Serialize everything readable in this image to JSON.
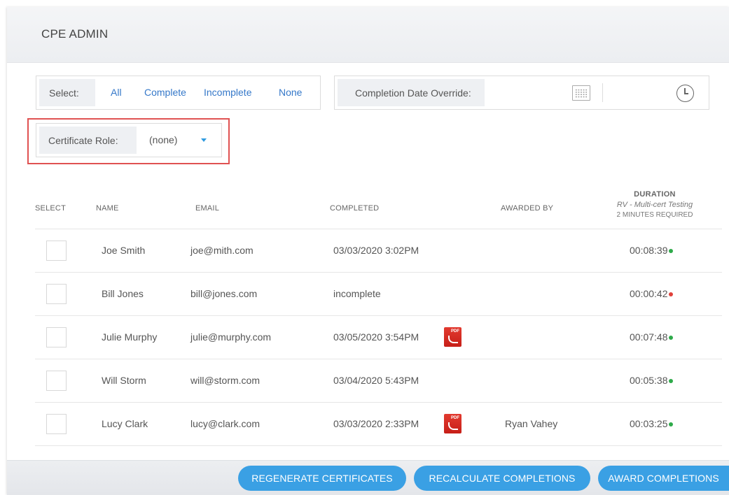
{
  "header": {
    "title": "CPE ADMIN"
  },
  "select": {
    "label": "Select:",
    "options": [
      "All",
      "Complete",
      "Incomplete",
      "None"
    ]
  },
  "date_override": {
    "label": "Completion Date Override:"
  },
  "certificate_role": {
    "label": "Certificate Role:",
    "value": "(none)"
  },
  "table": {
    "headers": {
      "select": "SELECT",
      "name": "NAME",
      "email": "EMAIL",
      "completed": "COMPLETED",
      "awarded_by": "AWARDED BY",
      "duration": "DURATION",
      "duration_sub": "RV - Multi-cert Testing",
      "duration_req": "2 MINUTES REQUIRED"
    },
    "rows": [
      {
        "name": "Joe Smith",
        "email": "joe@mith.com",
        "completed": "03/03/2020 3:02PM",
        "pdf": false,
        "awarded_by": "",
        "duration": "00:08:39",
        "status": "green"
      },
      {
        "name": "Bill Jones",
        "email": "bill@jones.com",
        "completed": "incomplete",
        "pdf": false,
        "awarded_by": "",
        "duration": "00:00:42",
        "status": "red"
      },
      {
        "name": "Julie Murphy",
        "email": "julie@murphy.com",
        "completed": "03/05/2020 3:54PM",
        "pdf": true,
        "awarded_by": "",
        "duration": "00:07:48",
        "status": "green"
      },
      {
        "name": "Will Storm",
        "email": "will@storm.com",
        "completed": "03/04/2020 5:43PM",
        "pdf": false,
        "awarded_by": "",
        "duration": "00:05:38",
        "status": "green"
      },
      {
        "name": "Lucy Clark",
        "email": "lucy@clark.com",
        "completed": "03/03/2020 2:33PM",
        "pdf": true,
        "awarded_by": "Ryan Vahey",
        "duration": "00:03:25",
        "status": "green"
      }
    ]
  },
  "pdf_icon_label": "PDF",
  "buttons": {
    "regenerate": "REGENERATE CERTIFICATES",
    "recalculate": "RECALCULATE COMPLETIONS",
    "award": "AWARD COMPLETIONS"
  },
  "colors": {
    "accent": "#3aa0e4",
    "link": "#3578c9",
    "status_green": "#2eaa4a",
    "status_red": "#e0413a",
    "highlight": "#e05252",
    "pdf_icon": "#d42a22"
  }
}
